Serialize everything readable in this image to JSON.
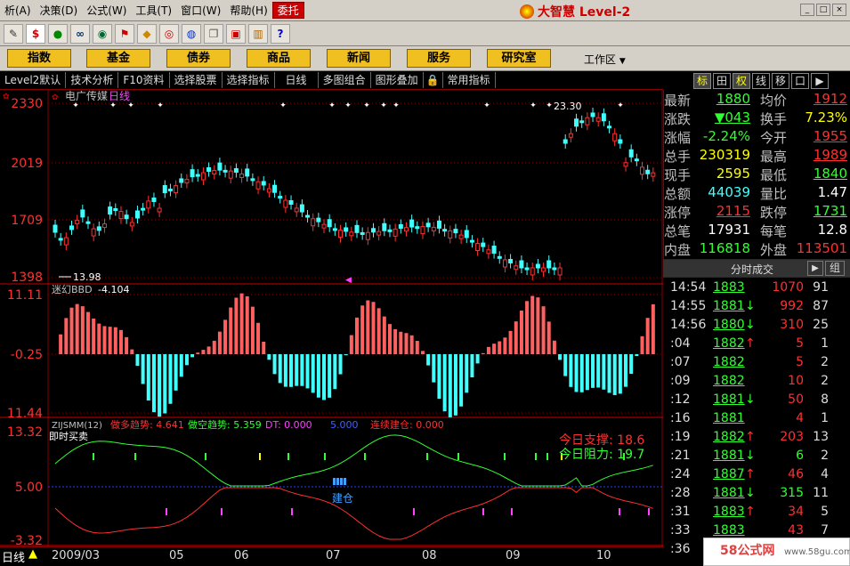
{
  "menu": [
    "析(A)",
    "决策(D)",
    "公式(W)",
    "工具(T)",
    "窗口(W)",
    "帮助(H)",
    "委托"
  ],
  "brand": "大智慧 Level-2",
  "window_controls": [
    "_",
    "□",
    "×"
  ],
  "toolbar_icons": [
    "pen-icon",
    "dollar-icon",
    "dots-icon",
    "binoculars-icon",
    "dial-icon",
    "flag-icon",
    "diamond-icon",
    "eye-icon",
    "globe-icon",
    "copy-icon",
    "window-icon",
    "books-icon",
    "help-cursor-icon"
  ],
  "nav_buttons": [
    "指数",
    "基金",
    "债券",
    "商品",
    "新闻",
    "服务",
    "研究室"
  ],
  "workzone": "工作区",
  "subbar": [
    "Level2默认",
    "技术分析",
    "F10资料",
    "选择股票",
    "选择指标",
    "日线",
    "多图组合",
    "图形叠加",
    "常用指标"
  ],
  "right_tabs": [
    "标",
    "田",
    "权",
    "线",
    "移",
    "口",
    "▶"
  ],
  "chart": {
    "stock_name": "电广传媒",
    "period": "日线",
    "price_ticks": [
      "2330",
      "2019",
      "1709",
      "1398"
    ],
    "high_label": "23.30",
    "low_label": "13.98",
    "ind1_name": "迷幻BBD",
    "ind1_value": "-4.104",
    "ind1_ticks": [
      "11.11",
      "-0.25",
      "11.44"
    ],
    "ind2_name": "ZIJSMM(12)",
    "ind2_sub": "即时买卖",
    "ind2_legend": [
      {
        "text": "做多趋势: 4.641",
        "color": "#ff3030"
      },
      {
        "text": "做空趋势: 5.359",
        "color": "#30ff30"
      },
      {
        "text": "DT: 0.000",
        "color": "#ff40ff"
      },
      {
        "text": "5.000",
        "color": "#4060ff"
      },
      {
        "text": "连续建仓: 0.000",
        "color": "#ff3030"
      }
    ],
    "ind2_ticks": [
      "13.32",
      "5.00",
      "-3.32"
    ],
    "support_label": "今日支撑: 18.6",
    "resistance_label": "今日阻力: 19.7",
    "jiancang": "建仓",
    "dates": [
      "2009/03",
      "05",
      "06",
      "07",
      "08",
      "09",
      "10"
    ],
    "period_status": "日线"
  },
  "quote": [
    {
      "l1": "最新",
      "v1": "1880",
      "c1": "#30ff30",
      "u1": true,
      "l2": "均价",
      "v2": "1912",
      "c2": "#ff3030",
      "u2": true
    },
    {
      "l1": "涨跌",
      "v1": "▼043",
      "c1": "#30ff30",
      "u1": true,
      "l2": "换手",
      "v2": "7.23%",
      "c2": "#ffff00",
      "u2": false
    },
    {
      "l1": "涨幅",
      "v1": "-2.24%",
      "c1": "#30ff30",
      "u1": false,
      "l2": "今开",
      "v2": "1955",
      "c2": "#ff3030",
      "u2": true
    },
    {
      "l1": "总手",
      "v1": "230319",
      "c1": "#ffff00",
      "u1": false,
      "l2": "最高",
      "v2": "1989",
      "c2": "#ff3030",
      "u2": true
    },
    {
      "l1": "现手",
      "v1": "2595",
      "c1": "#ffff00",
      "u1": false,
      "l2": "最低",
      "v2": "1840",
      "c2": "#30ff30",
      "u2": true
    },
    {
      "l1": "总额",
      "v1": "44039",
      "c1": "#40ffff",
      "u1": false,
      "l2": "量比",
      "v2": "1.47",
      "c2": "#ffffff",
      "u2": false
    },
    {
      "l1": "涨停",
      "v1": "2115",
      "c1": "#ff3030",
      "u1": true,
      "l2": "跌停",
      "v2": "1731",
      "c2": "#30ff30",
      "u2": true
    },
    {
      "l1": "总笔",
      "v1": "17931",
      "c1": "#ffffff",
      "u1": false,
      "l2": "每笔",
      "v2": "12.8",
      "c2": "#ffffff",
      "u2": false
    },
    {
      "l1": "内盘",
      "v1": "116818",
      "c1": "#30ff30",
      "u1": false,
      "l2": "外盘",
      "v2": "113501",
      "c2": "#ff3030",
      "u2": false
    }
  ],
  "trades_header": "分时成交",
  "trades_btn": "组",
  "trades": [
    {
      "t": "14:54",
      "p": "1883",
      "a": "",
      "v": "1070",
      "vc": "#ff3030",
      "n": "91"
    },
    {
      "t": "14:55",
      "p": "1881",
      "a": "↓",
      "v": "992",
      "vc": "#ff3030",
      "n": "87"
    },
    {
      "t": "14:56",
      "p": "1880",
      "a": "↓",
      "v": "310",
      "vc": "#ff3030",
      "n": "25"
    },
    {
      "t": ":04",
      "p": "1882",
      "a": "↑",
      "v": "5",
      "vc": "#ff3030",
      "n": "1"
    },
    {
      "t": ":07",
      "p": "1882",
      "a": "",
      "v": "5",
      "vc": "#ff3030",
      "n": "2"
    },
    {
      "t": ":09",
      "p": "1882",
      "a": "",
      "v": "10",
      "vc": "#ff3030",
      "n": "2"
    },
    {
      "t": ":12",
      "p": "1881",
      "a": "↓",
      "v": "50",
      "vc": "#ff3030",
      "n": "8"
    },
    {
      "t": ":16",
      "p": "1881",
      "a": "",
      "v": "4",
      "vc": "#ff3030",
      "n": "1"
    },
    {
      "t": ":19",
      "p": "1882",
      "a": "↑",
      "v": "203",
      "vc": "#ff3030",
      "n": "13"
    },
    {
      "t": ":21",
      "p": "1881",
      "a": "↓",
      "v": "6",
      "vc": "#30ff30",
      "n": "2"
    },
    {
      "t": ":24",
      "p": "1887",
      "a": "↑",
      "v": "46",
      "vc": "#ff3030",
      "n": "4"
    },
    {
      "t": ":28",
      "p": "1881",
      "a": "↓",
      "v": "315",
      "vc": "#30ff30",
      "n": "11"
    },
    {
      "t": ":31",
      "p": "1883",
      "a": "↑",
      "v": "34",
      "vc": "#ff3030",
      "n": "5"
    },
    {
      "t": ":33",
      "p": "1883",
      "a": "",
      "v": "43",
      "vc": "#ff3030",
      "n": "7"
    },
    {
      "t": ":36",
      "p": "1883",
      "a": "",
      "v": "",
      "vc": "#ff3030",
      "n": ""
    }
  ],
  "watermark": {
    "site": "58公式网",
    "url": "www.58gu.com"
  },
  "colors": {
    "up": "#ff3030",
    "down": "#40ffff",
    "grid": "#800000",
    "menu_bg": "#d4d0c8",
    "nav_btn": "#f0c020"
  }
}
